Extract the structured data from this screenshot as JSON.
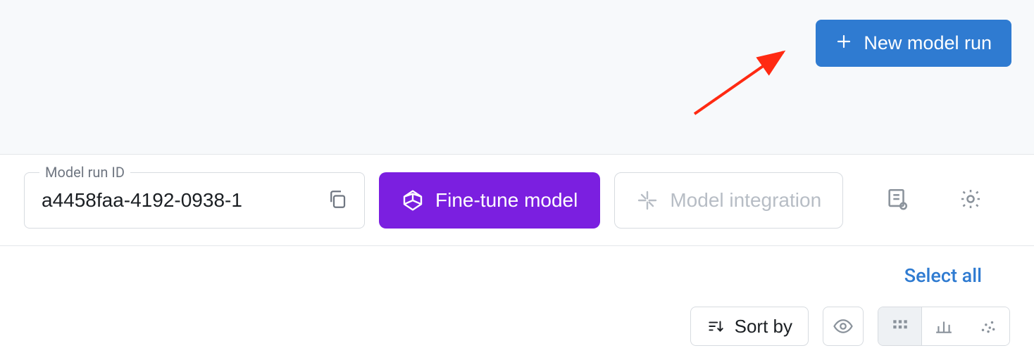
{
  "header": {
    "new_run_label": "New model run"
  },
  "toolbar": {
    "id_field_label": "Model run ID",
    "id_value": "a4458faa-4192-0938-1",
    "fine_tune_label": "Fine-tune model",
    "model_integration_label": "Model integration"
  },
  "subbar": {
    "select_all_label": "Select all",
    "sort_label": "Sort by"
  },
  "colors": {
    "primary_blue": "#2f7bd1",
    "primary_purple": "#7b1fe0",
    "muted": "#8a929b",
    "annotation_red": "#ff2a12"
  }
}
